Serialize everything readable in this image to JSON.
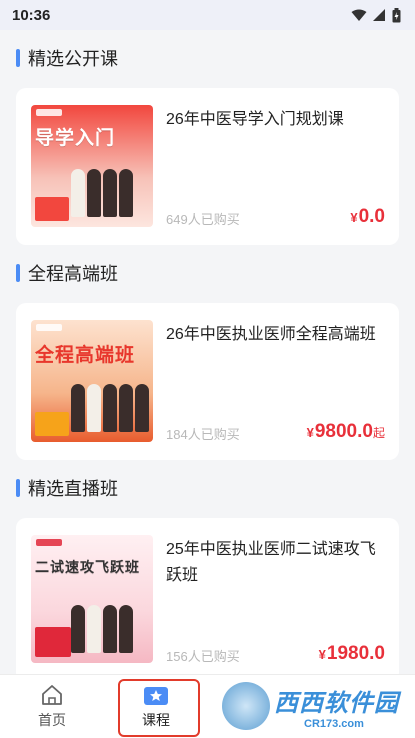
{
  "status": {
    "time": "10:36"
  },
  "sections": [
    {
      "title": "精选公开课",
      "course": {
        "title": "26年中医导学入门规划课",
        "thumb_text": "导学入门",
        "buyers": "649人已购买",
        "currency": "¥",
        "price": "0.0",
        "suffix": ""
      }
    },
    {
      "title": "全程高端班",
      "course": {
        "title": "26年中医执业医师全程高端班",
        "thumb_text": "全程高端班",
        "buyers": "184人已购买",
        "currency": "¥",
        "price": "9800.0",
        "suffix": "起"
      }
    },
    {
      "title": "精选直播班",
      "course": {
        "title": "25年中医执业医师二试速攻飞跃班",
        "thumb_text": "二试速攻飞跃班",
        "buyers": "156人已购买",
        "currency": "¥",
        "price": "1980.0",
        "suffix": ""
      }
    }
  ],
  "tabbar": {
    "home": "首页",
    "courses": "课程"
  },
  "watermark": {
    "main": "西西软件园",
    "sub": "CR173.com"
  },
  "colors": {
    "accent_bar": "#4b8cf5",
    "price": "#e8303a",
    "highlight_box": "#e23b2b"
  }
}
